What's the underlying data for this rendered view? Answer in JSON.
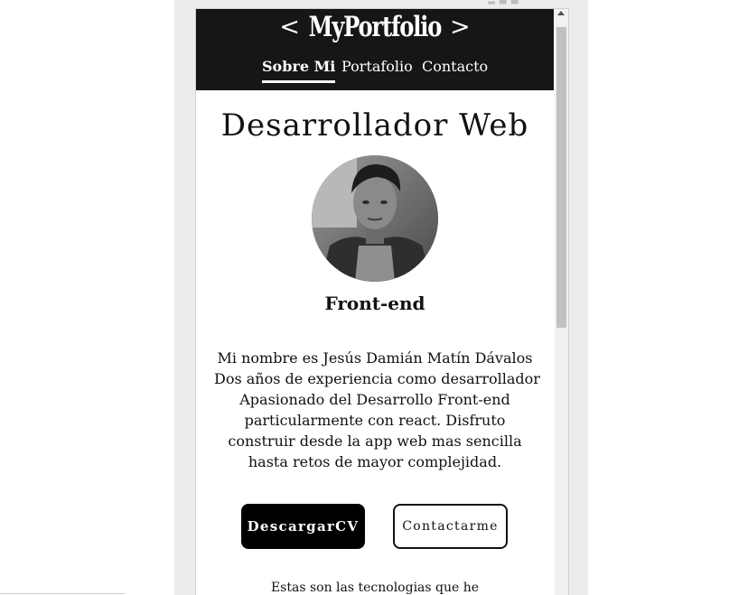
{
  "header": {
    "logo": {
      "left_bracket": "<",
      "brand": "MyPortfolio",
      "right_bracket": ">"
    },
    "nav": [
      {
        "label": "Sobre Mi",
        "active": true
      },
      {
        "label": "Portafolio",
        "active": false
      },
      {
        "label": "Contacto",
        "active": false
      }
    ]
  },
  "main": {
    "title": "Desarrollador Web",
    "role": "Front-end",
    "bio_lines": [
      "Mi nombre es Jesús Damián Matín Dávalos",
      "Dos años de experiencia como desarrollador",
      "Apasionado del Desarrollo Front-end",
      "particularmente con react. Disfruto",
      "construir desde la app web mas sencilla",
      "hasta retos de mayor complejidad."
    ],
    "buttons": {
      "download_cv": "DescargarCV",
      "contact": "Contactarme"
    },
    "tech_intro": "Estas son las tecnologias que he"
  },
  "colors": {
    "header_bg": "#161616",
    "primary_button_bg": "#000000",
    "text": "#111111"
  },
  "icons": {
    "scroll_up": "scroll-up-arrow-icon",
    "profile_photo": "profile-photo"
  }
}
